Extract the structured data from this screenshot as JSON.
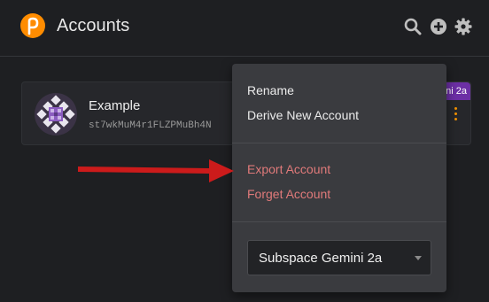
{
  "header": {
    "title": "Accounts",
    "logo_icon": "polkadot-logo-icon",
    "actions": [
      "search-icon",
      "add-icon",
      "gear-icon"
    ]
  },
  "account": {
    "name": "Example",
    "address": "st7wkMuM4r1FLZPMuBh4N",
    "network_badge": "ni 2a"
  },
  "menu": {
    "rename": "Rename",
    "derive": "Derive New Account",
    "export": "Export Account",
    "forget": "Forget Account",
    "network_select": "Subspace Gemini 2a"
  },
  "colors": {
    "accent": "#ff8c00",
    "danger": "#e07a7a",
    "badge": "#6c2fa5",
    "arrow": "#cc1b1b"
  }
}
